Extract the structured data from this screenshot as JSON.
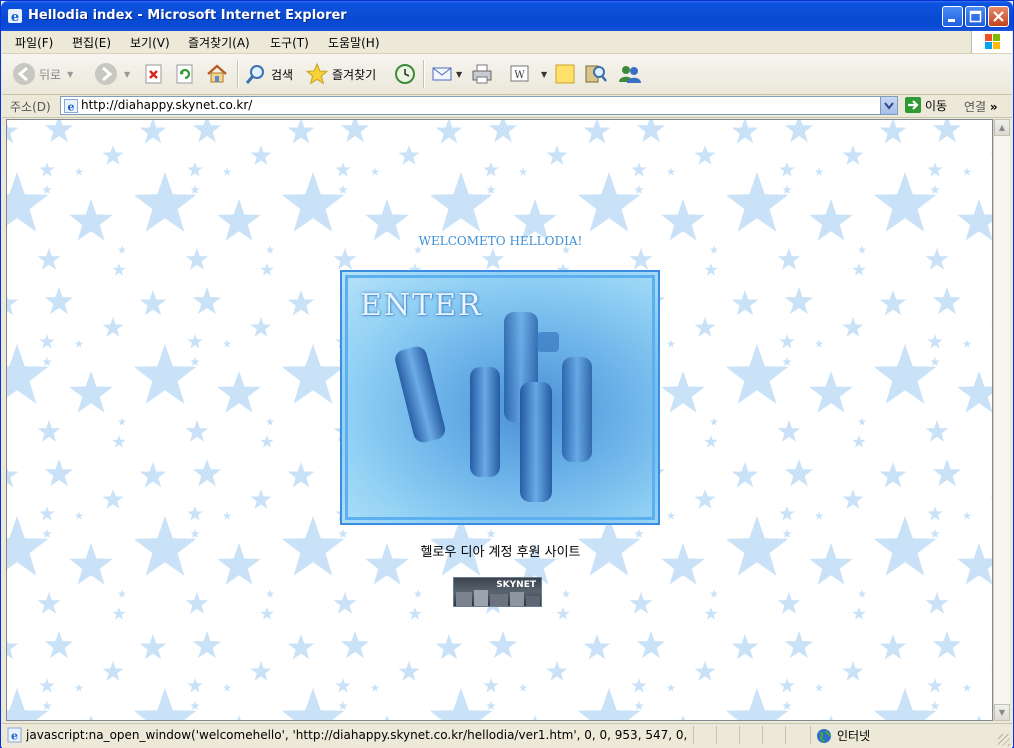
{
  "window": {
    "title": "Hellodia index - Microsoft Internet Explorer"
  },
  "menu": {
    "items": [
      "파일(F)",
      "편집(E)",
      "보기(V)",
      "즐겨찾기(A)",
      "도구(T)",
      "도움말(H)"
    ]
  },
  "toolbar": {
    "back_label": "뒤로",
    "search_label": "검색",
    "favorites_label": "즐겨찾기"
  },
  "address": {
    "label": "주소(D)",
    "url": "http://diahappy.skynet.co.kr/",
    "go_label": "이동",
    "links_label": "연결"
  },
  "page": {
    "welcome": "WELCOMETO HELLODIA!",
    "enter_text": "ENTER",
    "subtitle": "헬로우 디아 계정 후원 사이트",
    "banner_text": "SKYNET"
  },
  "status": {
    "text": "javascript:na_open_window('welcomehello', 'http://diahappy.skynet.co.kr/hellodia/ver1.htm', 0, 0, 953, 547, 0, 0, 1, 0",
    "zone": "인터넷"
  },
  "colors": {
    "title_bar": "#0b4bd8",
    "welcome_text": "#3d8fd6",
    "star": "#c9e2f8"
  }
}
